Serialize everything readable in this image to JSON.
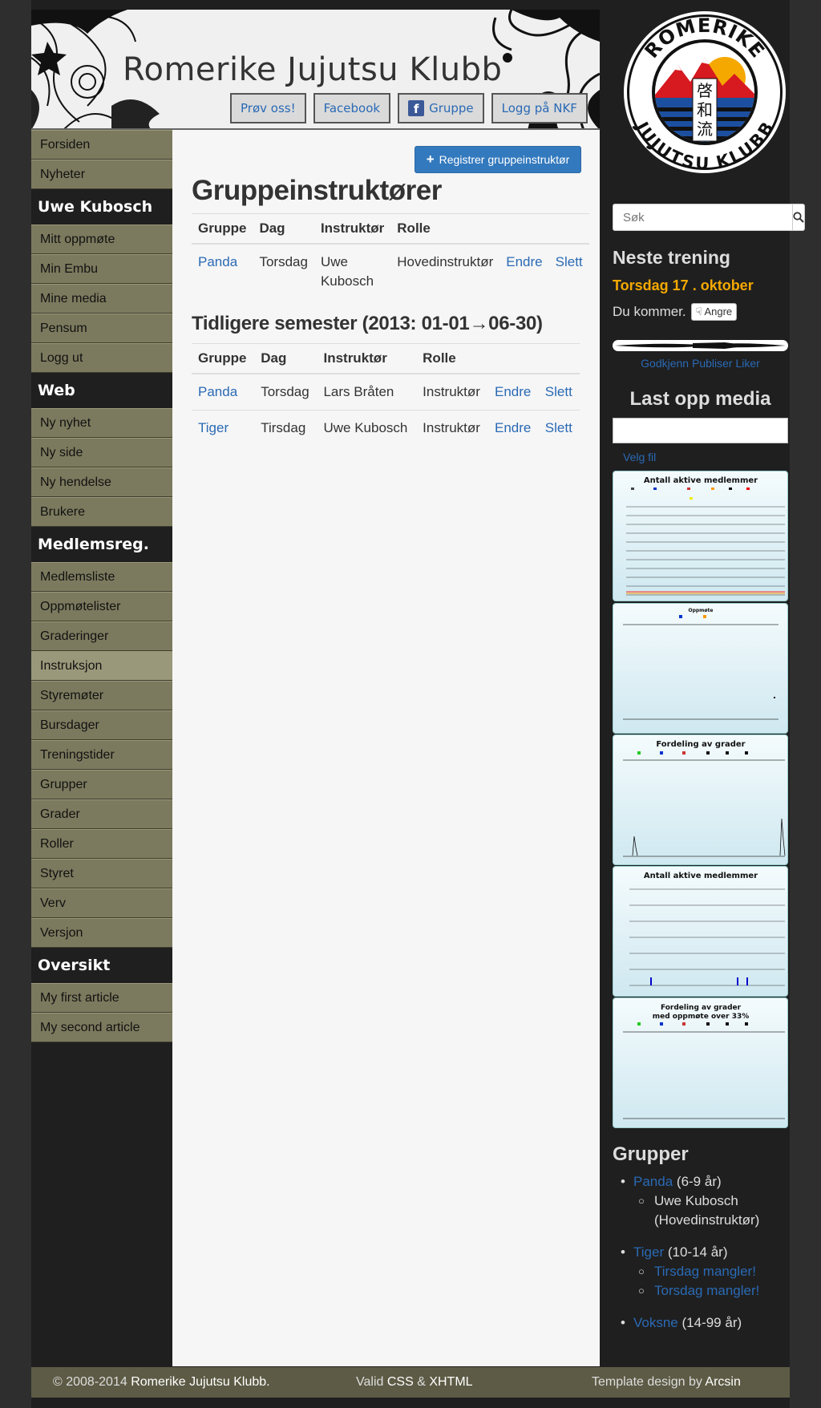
{
  "header": {
    "title": "Romerike Jujutsu Klubb",
    "buttons": [
      "Prøv oss!",
      "Facebook",
      "Gruppe",
      "Logg på NKF"
    ]
  },
  "nav": {
    "top": [
      "Forsiden",
      "Nyheter"
    ],
    "user_head": "Uwe Kubosch",
    "user": [
      "Mitt oppmøte",
      "Min Embu",
      "Mine media",
      "Pensum",
      "Logg ut"
    ],
    "web_head": "Web",
    "web": [
      "Ny nyhet",
      "Ny side",
      "Ny hendelse",
      "Brukere"
    ],
    "reg_head": "Medlemsreg.",
    "reg": [
      "Medlemsliste",
      "Oppmøtelister",
      "Graderinger",
      "Instruksjon",
      "Styremøter",
      "Bursdager",
      "Treningstider",
      "Grupper",
      "Grader",
      "Roller",
      "Styret",
      "Verv",
      "Versjon"
    ],
    "ov_head": "Oversikt",
    "ov": [
      "My first article",
      "My second article"
    ]
  },
  "main": {
    "register_button": "Registrer gruppeinstruktør",
    "title": "Gruppeinstruktører",
    "columns": [
      "Gruppe",
      "Dag",
      "Instruktør",
      "Rolle"
    ],
    "current": [
      {
        "group": "Panda",
        "day": "Torsdag",
        "instructor": "Uwe Kubosch",
        "role": "Hovedinstruktør",
        "edit": "Endre",
        "delete": "Slett"
      }
    ],
    "previous_title": "Tidligere semester (2013: 01-01→06-30)",
    "previous": [
      {
        "group": "Panda",
        "day": "Torsdag",
        "instructor": "Lars Bråten",
        "role": "Instruktør",
        "edit": "Endre",
        "delete": "Slett"
      },
      {
        "group": "Tiger",
        "day": "Tirsdag",
        "instructor": "Uwe Kubosch",
        "role": "Instruktør",
        "edit": "Endre",
        "delete": "Slett"
      }
    ]
  },
  "right": {
    "logo_top": "ROMERIKE",
    "logo_bottom": "JUJUTSU KLUBB",
    "logo_chars": [
      "啓",
      "和",
      "流"
    ],
    "search_placeholder": "Søk",
    "next_training_title": "Neste trening",
    "next_training_date": "Torsdag 17 . oktober",
    "attending_text": "Du kommer.",
    "undo_button": "Angre",
    "links": [
      "Godkjenn",
      "Publiser",
      "Liker"
    ],
    "upload_title": "Last opp media",
    "choose_file": "Velg fil",
    "thumb_titles": [
      "Antall aktive medlemmer",
      "Oppmøte",
      "Fordeling av grader",
      "Antall aktive medlemmer",
      "Fordeling av grader",
      "med oppmøte over 33%"
    ],
    "groups_title": "Grupper",
    "groups": [
      {
        "name": "Panda",
        "ages": "(6-9 år)",
        "items": [
          "Uwe Kubosch (Hovedinstruktør)"
        ],
        "item_links": []
      },
      {
        "name": "Tiger",
        "ages": "(10-14 år)",
        "items": [],
        "item_links": [
          "Tirsdag mangler!",
          "Torsdag mangler!"
        ]
      },
      {
        "name": "Voksne",
        "ages": "(14-99 år)",
        "items": [],
        "item_links": []
      }
    ]
  },
  "footer": {
    "copyright": "© 2008-2014",
    "club": "Romerike Jujutsu Klubb.",
    "valid": "Valid",
    "css": "CSS",
    "amp": "&",
    "xhtml": "XHTML",
    "design": "Template design by",
    "designer": "Arcsin"
  }
}
